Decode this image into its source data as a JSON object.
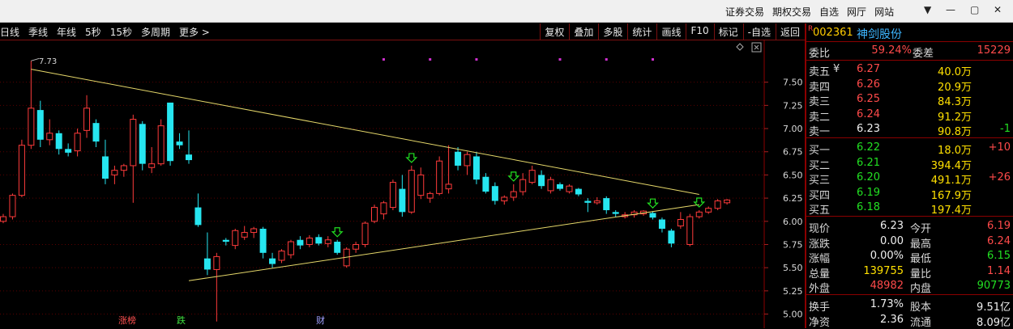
{
  "topbar": {
    "menu": [
      "证券交易",
      "期权交易",
      "自选",
      "网厅",
      "网站"
    ],
    "controls": [
      "▼",
      "—",
      "▢",
      "✕"
    ]
  },
  "toolbar": {
    "periods": [
      "日线",
      "季线",
      "年线",
      "5秒",
      "15秒",
      "多周期",
      "更多 >"
    ],
    "tools": [
      "复权",
      "叠加",
      "多股",
      "统计",
      "画线",
      "F10",
      "标记",
      "-自选",
      "返回"
    ]
  },
  "chart": {
    "y_ticks": [
      "7.50",
      "7.25",
      "7.00",
      "6.75",
      "6.50",
      "6.25",
      "6.00",
      "5.75",
      "5.50",
      "5.25",
      "5.00"
    ],
    "high_label": "7.73",
    "bottom_tags": [
      {
        "text": "涨榜",
        "color": "#ff5050"
      },
      {
        "text": "跌",
        "color": "#40e040"
      },
      {
        "text": "财",
        "color": "#a0a0ff"
      }
    ],
    "icons": [
      "diamond-icon",
      "settings-box-icon"
    ]
  },
  "chart_data": {
    "type": "candlestick",
    "ylim": [
      4.9,
      7.75
    ],
    "candles": [
      {
        "o": 6.0,
        "h": 6.08,
        "l": 5.98,
        "c": 6.05
      },
      {
        "o": 6.05,
        "h": 6.3,
        "l": 6.02,
        "c": 6.28
      },
      {
        "o": 6.28,
        "h": 6.88,
        "l": 6.26,
        "c": 6.82
      },
      {
        "o": 6.82,
        "h": 7.73,
        "l": 6.78,
        "c": 7.22
      },
      {
        "o": 7.2,
        "h": 7.3,
        "l": 6.8,
        "c": 6.88
      },
      {
        "o": 6.88,
        "h": 7.1,
        "l": 6.82,
        "c": 6.95
      },
      {
        "o": 6.95,
        "h": 6.98,
        "l": 6.72,
        "c": 6.78
      },
      {
        "o": 6.78,
        "h": 6.84,
        "l": 6.7,
        "c": 6.74
      },
      {
        "o": 6.76,
        "h": 7.0,
        "l": 6.7,
        "c": 6.95
      },
      {
        "o": 6.98,
        "h": 7.36,
        "l": 6.9,
        "c": 7.22
      },
      {
        "o": 7.06,
        "h": 7.1,
        "l": 6.8,
        "c": 6.86
      },
      {
        "o": 6.7,
        "h": 6.88,
        "l": 6.4,
        "c": 6.46
      },
      {
        "o": 6.5,
        "h": 6.6,
        "l": 6.4,
        "c": 6.55
      },
      {
        "o": 6.55,
        "h": 6.62,
        "l": 6.48,
        "c": 6.6
      },
      {
        "o": 6.6,
        "h": 7.15,
        "l": 6.2,
        "c": 7.1
      },
      {
        "o": 7.05,
        "h": 7.08,
        "l": 6.55,
        "c": 6.62
      },
      {
        "o": 6.58,
        "h": 6.8,
        "l": 6.52,
        "c": 6.62
      },
      {
        "o": 6.62,
        "h": 7.1,
        "l": 6.6,
        "c": 7.03
      },
      {
        "o": 7.28,
        "h": 7.28,
        "l": 6.6,
        "c": 6.65
      },
      {
        "o": 6.86,
        "h": 6.95,
        "l": 6.78,
        "c": 6.82
      },
      {
        "o": 6.72,
        "h": 6.98,
        "l": 6.62,
        "c": 6.66
      },
      {
        "o": 6.15,
        "h": 6.3,
        "l": 5.94,
        "c": 5.96
      },
      {
        "o": 5.6,
        "h": 5.88,
        "l": 5.42,
        "c": 5.48
      },
      {
        "o": 5.48,
        "h": 5.66,
        "l": 4.92,
        "c": 5.62
      },
      {
        "o": 5.8,
        "h": 5.82,
        "l": 5.74,
        "c": 5.78
      },
      {
        "o": 5.74,
        "h": 5.92,
        "l": 5.7,
        "c": 5.9
      },
      {
        "o": 5.83,
        "h": 5.95,
        "l": 5.8,
        "c": 5.88
      },
      {
        "o": 5.88,
        "h": 5.94,
        "l": 5.82,
        "c": 5.92
      },
      {
        "o": 5.92,
        "h": 5.94,
        "l": 5.6,
        "c": 5.66
      },
      {
        "o": 5.6,
        "h": 5.66,
        "l": 5.5,
        "c": 5.54
      },
      {
        "o": 5.58,
        "h": 5.7,
        "l": 5.55,
        "c": 5.68
      },
      {
        "o": 5.64,
        "h": 5.8,
        "l": 5.6,
        "c": 5.78
      },
      {
        "o": 5.8,
        "h": 5.84,
        "l": 5.7,
        "c": 5.74
      },
      {
        "o": 5.75,
        "h": 5.85,
        "l": 5.72,
        "c": 5.82
      },
      {
        "o": 5.83,
        "h": 5.86,
        "l": 5.74,
        "c": 5.76
      },
      {
        "o": 5.76,
        "h": 5.84,
        "l": 5.72,
        "c": 5.8
      },
      {
        "o": 5.78,
        "h": 5.8,
        "l": 5.64,
        "c": 5.66
      },
      {
        "o": 5.52,
        "h": 5.72,
        "l": 5.5,
        "c": 5.7
      },
      {
        "o": 5.7,
        "h": 5.78,
        "l": 5.66,
        "c": 5.75
      },
      {
        "o": 5.75,
        "h": 6.0,
        "l": 5.72,
        "c": 5.98
      },
      {
        "o": 6.0,
        "h": 6.18,
        "l": 5.98,
        "c": 6.15
      },
      {
        "o": 6.08,
        "h": 6.22,
        "l": 6.02,
        "c": 6.2
      },
      {
        "o": 6.15,
        "h": 6.45,
        "l": 6.12,
        "c": 6.42
      },
      {
        "o": 6.35,
        "h": 6.5,
        "l": 6.05,
        "c": 6.1
      },
      {
        "o": 6.1,
        "h": 6.6,
        "l": 6.08,
        "c": 6.55
      },
      {
        "o": 6.28,
        "h": 6.58,
        "l": 6.24,
        "c": 6.5
      },
      {
        "o": 6.25,
        "h": 6.32,
        "l": 6.2,
        "c": 6.3
      },
      {
        "o": 6.3,
        "h": 6.7,
        "l": 6.28,
        "c": 6.65
      },
      {
        "o": 6.35,
        "h": 6.82,
        "l": 6.3,
        "c": 6.4
      },
      {
        "o": 6.75,
        "h": 6.8,
        "l": 6.55,
        "c": 6.6
      },
      {
        "o": 6.6,
        "h": 6.75,
        "l": 6.5,
        "c": 6.72
      },
      {
        "o": 6.7,
        "h": 6.75,
        "l": 6.4,
        "c": 6.45
      },
      {
        "o": 6.48,
        "h": 6.52,
        "l": 6.3,
        "c": 6.32
      },
      {
        "o": 6.38,
        "h": 6.42,
        "l": 6.18,
        "c": 6.22
      },
      {
        "o": 6.22,
        "h": 6.28,
        "l": 6.18,
        "c": 6.26
      },
      {
        "o": 6.26,
        "h": 6.4,
        "l": 6.22,
        "c": 6.32
      },
      {
        "o": 6.32,
        "h": 6.52,
        "l": 6.28,
        "c": 6.45
      },
      {
        "o": 6.42,
        "h": 6.6,
        "l": 6.4,
        "c": 6.55
      },
      {
        "o": 6.5,
        "h": 6.55,
        "l": 6.35,
        "c": 6.38
      },
      {
        "o": 6.33,
        "h": 6.48,
        "l": 6.3,
        "c": 6.45
      },
      {
        "o": 6.4,
        "h": 6.42,
        "l": 6.33,
        "c": 6.35
      },
      {
        "o": 6.32,
        "h": 6.4,
        "l": 6.3,
        "c": 6.38
      },
      {
        "o": 6.35,
        "h": 6.36,
        "l": 6.27,
        "c": 6.29
      },
      {
        "o": 6.22,
        "h": 6.25,
        "l": 6.1,
        "c": 6.2
      },
      {
        "o": 6.2,
        "h": 6.26,
        "l": 6.18,
        "c": 6.22
      },
      {
        "o": 6.25,
        "h": 6.27,
        "l": 6.08,
        "c": 6.12
      },
      {
        "o": 6.1,
        "h": 6.12,
        "l": 6.05,
        "c": 6.08
      },
      {
        "o": 6.05,
        "h": 6.1,
        "l": 6.03,
        "c": 6.07
      },
      {
        "o": 6.07,
        "h": 6.12,
        "l": 6.04,
        "c": 6.1
      },
      {
        "o": 6.08,
        "h": 6.12,
        "l": 6.06,
        "c": 6.11
      },
      {
        "o": 6.09,
        "h": 6.11,
        "l": 6.02,
        "c": 6.04
      },
      {
        "o": 6.02,
        "h": 6.04,
        "l": 5.88,
        "c": 5.92
      },
      {
        "o": 5.9,
        "h": 5.92,
        "l": 5.72,
        "c": 5.76
      },
      {
        "o": 5.95,
        "h": 6.1,
        "l": 5.92,
        "c": 6.02
      },
      {
        "o": 5.75,
        "h": 6.08,
        "l": 5.73,
        "c": 6.05
      },
      {
        "o": 6.05,
        "h": 6.12,
        "l": 6.03,
        "c": 6.1
      },
      {
        "o": 6.1,
        "h": 6.16,
        "l": 6.08,
        "c": 6.14
      },
      {
        "o": 6.14,
        "h": 6.24,
        "l": 6.12,
        "c": 6.22
      },
      {
        "o": 6.2,
        "h": 6.24,
        "l": 6.18,
        "c": 6.23
      }
    ],
    "trendlines": [
      {
        "from": [
          3,
          7.64
        ],
        "to": [
          75,
          6.29
        ]
      },
      {
        "from": [
          20,
          5.36
        ],
        "to": [
          75,
          6.18
        ]
      }
    ],
    "signal_arrows": [
      36,
      44,
      55,
      70,
      75
    ],
    "top_markers": [
      41,
      46,
      51,
      60,
      65,
      70
    ]
  },
  "quote": {
    "mark": "R",
    "code": "002361",
    "name": "神剑股份",
    "webi_label": "委比",
    "webi_value": "59.24%",
    "weicha_label": "委差",
    "weicha_value": "15229",
    "asks": [
      {
        "label": "卖五",
        "sym": "¥",
        "price": "6.27",
        "vol": "40.0万",
        "chg": ""
      },
      {
        "label": "卖四",
        "sym": "",
        "price": "6.26",
        "vol": "20.9万",
        "chg": ""
      },
      {
        "label": "卖三",
        "sym": "",
        "price": "6.25",
        "vol": "84.3万",
        "chg": ""
      },
      {
        "label": "卖二",
        "sym": "",
        "price": "6.24",
        "vol": "91.2万",
        "chg": ""
      },
      {
        "label": "卖一",
        "sym": "",
        "price": "6.23",
        "vol": "90.8万",
        "chg": "-1"
      }
    ],
    "bids": [
      {
        "label": "买一",
        "price": "6.22",
        "vol": "18.0万",
        "chg": "+10"
      },
      {
        "label": "买二",
        "price": "6.21",
        "vol": "394.4万",
        "chg": ""
      },
      {
        "label": "买三",
        "price": "6.20",
        "vol": "491.1万",
        "chg": "+26"
      },
      {
        "label": "买四",
        "price": "6.19",
        "vol": "167.9万",
        "chg": ""
      },
      {
        "label": "买五",
        "price": "6.18",
        "vol": "197.4万",
        "chg": ""
      }
    ],
    "stats": [
      {
        "l1": "现价",
        "v1": "6.23",
        "c1": "white",
        "l2": "今开",
        "v2": "6.19",
        "c2": "red"
      },
      {
        "l1": "涨跌",
        "v1": "0.00",
        "c1": "white",
        "l2": "最高",
        "v2": "6.24",
        "c2": "red"
      },
      {
        "l1": "涨幅",
        "v1": "0.00%",
        "c1": "white",
        "l2": "最低",
        "v2": "6.15",
        "c2": "green"
      },
      {
        "l1": "总量",
        "v1": "139755",
        "c1": "yellow",
        "l2": "量比",
        "v2": "1.14",
        "c2": "red"
      },
      {
        "l1": "外盘",
        "v1": "48982",
        "c1": "red",
        "l2": "内盘",
        "v2": "90773",
        "c2": "green"
      }
    ],
    "stats2": [
      {
        "l1": "换手",
        "v1": "1.73%",
        "c1": "white",
        "l2": "股本",
        "v2": "9.51亿",
        "c2": "white"
      },
      {
        "l1": "净资",
        "v1": "2.36",
        "c1": "white",
        "l2": "流通",
        "v2": "8.09亿",
        "c2": "white"
      }
    ]
  }
}
